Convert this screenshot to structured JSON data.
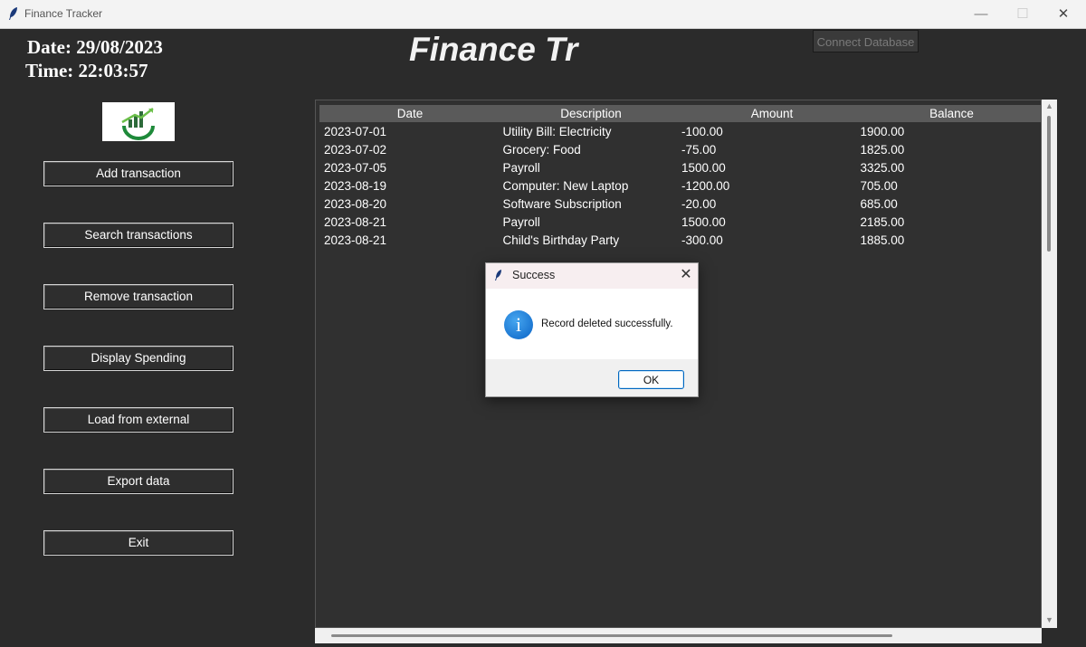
{
  "window": {
    "title": "Finance Tracker",
    "controls": {
      "minimize": "—",
      "maximize": "☐",
      "close": "✕"
    }
  },
  "header": {
    "date_text": "Date: 29/08/2023",
    "time_text": "Time: 22:03:57",
    "app_title": "Finance Tr",
    "connect_label": "Connect Database"
  },
  "sidebar": {
    "buttons": [
      {
        "label": "Add transaction"
      },
      {
        "label": "Search transactions"
      },
      {
        "label": "Remove transaction"
      },
      {
        "label": "Display Spending"
      },
      {
        "label": "Load from external"
      },
      {
        "label": "Export data"
      },
      {
        "label": "Exit"
      }
    ]
  },
  "table": {
    "columns": [
      "Date",
      "Description",
      "Amount",
      "Balance"
    ],
    "rows": [
      [
        "2023-07-01",
        "Utility Bill: Electricity",
        "-100.00",
        "1900.00"
      ],
      [
        "2023-07-02",
        "Grocery: Food",
        "-75.00",
        "1825.00"
      ],
      [
        "2023-07-05",
        "Payroll",
        "1500.00",
        "3325.00"
      ],
      [
        "2023-08-19",
        "Computer: New Laptop",
        "-1200.00",
        "705.00"
      ],
      [
        "2023-08-20",
        "Software Subscription",
        "-20.00",
        "685.00"
      ],
      [
        "2023-08-21",
        "Payroll",
        "1500.00",
        "2185.00"
      ],
      [
        "2023-08-21",
        "Child's Birthday Party",
        "-300.00",
        "1885.00"
      ]
    ]
  },
  "dialog": {
    "title": "Success",
    "message": "Record deleted successfully.",
    "ok_label": "OK",
    "info_glyph": "i",
    "close_glyph": "✕"
  },
  "colors": {
    "background": "#2b2b2b",
    "header_row": "#5a5a5a",
    "logo_green": "#1e8a3a",
    "info_blue": "#0a63c6"
  },
  "icons": {
    "app": "feather-icon",
    "logo": "growth-chart-logo",
    "dialog": "information-icon"
  }
}
